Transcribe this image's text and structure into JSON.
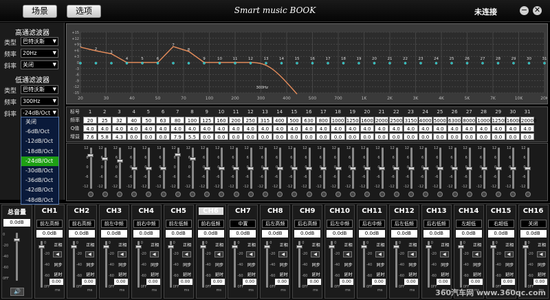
{
  "titlebar": {
    "scene": "场景",
    "options": "选项",
    "title": "Smart music BOOK",
    "status": "未连接",
    "minimize": "−",
    "close": "✕"
  },
  "hp": {
    "title": "高通滤波器",
    "type_label": "类型",
    "type": "巴特沃斯",
    "freq_label": "频率",
    "freq": "20Hz",
    "slope_label": "斜率",
    "slope": "关闭"
  },
  "lp": {
    "title": "低通滤波器",
    "type_label": "类型",
    "type": "巴特沃斯",
    "freq_label": "频率",
    "freq": "300Hz",
    "slope_label": "斜率",
    "slope": "-24dB/Oct"
  },
  "slope_options": [
    "关闭",
    "-6dB/Oct",
    "-12dB/Oct",
    "-18dB/Oct",
    "-24dB/Oct",
    "-30dB/Oct",
    "-36dB/Oct",
    "-42dB/Oct",
    "-48dB/Oct"
  ],
  "slope_selected_index": 4,
  "graph": {
    "y_labels": [
      "+15",
      "+12",
      "+9",
      "+6",
      "+3",
      "0",
      "-3",
      "-6",
      "-9",
      "-12",
      "-15"
    ],
    "x_labels": [
      "20",
      "30",
      "40",
      "50",
      "70",
      "100",
      "200",
      "300",
      "400",
      "500",
      "700",
      "1K",
      "2K",
      "3K",
      "4K",
      "5K",
      "7K",
      "10K",
      "20K"
    ],
    "cutoff_label": "300Hz",
    "band_points": [
      "1",
      "2",
      "3",
      "4",
      "5",
      "6",
      "7",
      "8",
      "9",
      "10",
      "11",
      "12",
      "13",
      "14",
      "15",
      "16",
      "17",
      "18",
      "19",
      "20",
      "21",
      "22",
      "23",
      "24",
      "25",
      "26",
      "27",
      "28",
      "29",
      "30",
      "31"
    ]
  },
  "table": {
    "labels": [
      "标号",
      "频率",
      "Q值",
      "增益"
    ],
    "bands": [
      "1",
      "2",
      "3",
      "4",
      "5",
      "6",
      "7",
      "8",
      "9",
      "10",
      "11",
      "12",
      "13",
      "14",
      "15",
      "16",
      "17",
      "18",
      "19",
      "20",
      "21",
      "22",
      "23",
      "24",
      "25",
      "26",
      "27",
      "28",
      "29",
      "30",
      "31"
    ],
    "freqs": [
      "20",
      "25",
      "32",
      "40",
      "50",
      "63",
      "80",
      "100",
      "125",
      "160",
      "200",
      "250",
      "315",
      "400",
      "500",
      "630",
      "800",
      "1000",
      "1250",
      "1600",
      "2000",
      "2500",
      "3150",
      "4000",
      "5000",
      "6300",
      "8000",
      "10000",
      "12500",
      "16000",
      "20000"
    ],
    "q": [
      "4.0",
      "4.0",
      "4.0",
      "4.0",
      "4.0",
      "4.0",
      "4.0",
      "4.0",
      "4.0",
      "4.0",
      "4.0",
      "4.0",
      "4.0",
      "4.0",
      "4.0",
      "4.0",
      "4.0",
      "4.0",
      "4.0",
      "4.0",
      "4.0",
      "4.0",
      "4.0",
      "4.0",
      "4.0",
      "4.0",
      "4.0",
      "4.0",
      "4.0",
      "4.0",
      "4.0"
    ],
    "gain": [
      "7.6",
      "5.8",
      "4.3",
      "0.0",
      "0.0",
      "0.0",
      "7.9",
      "5.5",
      "0.0",
      "0.0",
      "0.0",
      "0.0",
      "0.0",
      "0.0",
      "0.0",
      "0.0",
      "0.0",
      "0.0",
      "0.0",
      "0.0",
      "0.0",
      "0.0",
      "0.0",
      "0.0",
      "0.0",
      "0.0",
      "0.0",
      "0.0",
      "0.0",
      "0.0",
      "0.0"
    ]
  },
  "slider_scale": [
    "12",
    "6",
    "0",
    "-6",
    "-12"
  ],
  "master": {
    "title": "总音量",
    "value": "0.0dB",
    "scale": [
      "0",
      "-20",
      "-40",
      "-60",
      "0FF"
    ]
  },
  "channels": [
    {
      "id": "CH1",
      "name": "前左高频",
      "value": "0.0dB",
      "delay": "0.00"
    },
    {
      "id": "CH2",
      "name": "前右高频",
      "value": "0.0dB",
      "delay": "0.00"
    },
    {
      "id": "CH3",
      "name": "前左中频",
      "value": "0.0dB",
      "delay": "0.00"
    },
    {
      "id": "CH4",
      "name": "前右中频",
      "value": "0.0dB",
      "delay": "0.00"
    },
    {
      "id": "CH5",
      "name": "前左低频",
      "value": "0.0dB",
      "delay": "0.00"
    },
    {
      "id": "CH6",
      "name": "前右低频",
      "value": "0.0dB",
      "delay": "0.00"
    },
    {
      "id": "CH7",
      "name": "中置",
      "value": "0.0dB",
      "delay": "0.00"
    },
    {
      "id": "CH8",
      "name": "后左高频",
      "value": "0.0dB",
      "delay": "0.00"
    },
    {
      "id": "CH9",
      "name": "后右高频",
      "value": "0.0dB",
      "delay": "0.00"
    },
    {
      "id": "CH10",
      "name": "后左中频",
      "value": "0.0dB",
      "delay": "0.00"
    },
    {
      "id": "CH11",
      "name": "后右中频",
      "value": "0.0dB",
      "delay": "0.00"
    },
    {
      "id": "CH12",
      "name": "后左低频",
      "value": "0.0dB",
      "delay": "0.00"
    },
    {
      "id": "CH13",
      "name": "后右低频",
      "value": "0.0dB",
      "delay": "0.00"
    },
    {
      "id": "CH14",
      "name": "左超低",
      "value": "0.0dB",
      "delay": "0.00"
    },
    {
      "id": "CH15",
      "name": "右超低",
      "value": "0.0dB",
      "delay": "0.00"
    },
    {
      "id": "CH16",
      "name": "关闭",
      "value": "0.0dB",
      "delay": "0.00"
    }
  ],
  "channel_labels": {
    "phase": "正相",
    "sync": "同步",
    "delay": "延时",
    "ms": "ms",
    "scale": [
      "0",
      "-20",
      "-40",
      "-60",
      "0FF"
    ]
  },
  "active_channel": "CH6",
  "watermark": "360汽车网 www.360qc.com",
  "colors": {
    "accent": "#1ea014",
    "curve": "#e08a5a"
  }
}
